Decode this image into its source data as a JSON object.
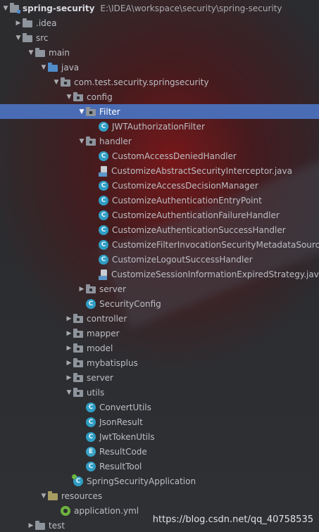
{
  "tree": [
    {
      "label": "spring-security",
      "path": "E:\\IDEA\\workspace\\security\\spring-security",
      "icon": "module-folder-icon",
      "arrow": "open"
    },
    {
      "label": ".idea",
      "icon": "folder-icon",
      "arrow": "closed"
    },
    {
      "label": "src",
      "icon": "folder-icon",
      "arrow": "open"
    },
    {
      "label": "main",
      "icon": "folder-icon",
      "arrow": "open"
    },
    {
      "label": "java",
      "icon": "source-folder-icon",
      "arrow": "open"
    },
    {
      "label": "com.test.security.springsecurity",
      "icon": "package-icon",
      "arrow": "open"
    },
    {
      "label": "config",
      "icon": "package-icon",
      "arrow": "open"
    },
    {
      "label": "Filter",
      "icon": "package-icon",
      "arrow": "open",
      "selected": true
    },
    {
      "label": "JWTAuthorizationFilter",
      "icon": "class-icon"
    },
    {
      "label": "handler",
      "icon": "package-icon",
      "arrow": "open"
    },
    {
      "label": "CustomAccessDeniedHandler",
      "icon": "class-icon"
    },
    {
      "label": "CustomizeAbstractSecurityInterceptor.java",
      "icon": "java-file-icon"
    },
    {
      "label": "CustomizeAccessDecisionManager",
      "icon": "class-icon"
    },
    {
      "label": "CustomizeAuthenticationEntryPoint",
      "icon": "class-icon"
    },
    {
      "label": "CustomizeAuthenticationFailureHandler",
      "icon": "class-icon"
    },
    {
      "label": "CustomizeAuthenticationSuccessHandler",
      "icon": "class-icon"
    },
    {
      "label": "CustomizeFilterInvocationSecurityMetadataSourc",
      "icon": "class-icon"
    },
    {
      "label": "CustomizeLogoutSuccessHandler",
      "icon": "class-icon"
    },
    {
      "label": "CustomizeSessionInformationExpiredStrategy.jav",
      "icon": "java-file-icon"
    },
    {
      "label": "server",
      "icon": "package-icon",
      "arrow": "closed"
    },
    {
      "label": "SecurityConfig",
      "icon": "class-icon"
    },
    {
      "label": "controller",
      "icon": "package-icon",
      "arrow": "closed"
    },
    {
      "label": "mapper",
      "icon": "package-icon",
      "arrow": "closed"
    },
    {
      "label": "model",
      "icon": "package-icon",
      "arrow": "closed"
    },
    {
      "label": "mybatisplus",
      "icon": "package-icon",
      "arrow": "closed"
    },
    {
      "label": "server",
      "icon": "package-icon",
      "arrow": "closed"
    },
    {
      "label": "utils",
      "icon": "package-icon",
      "arrow": "open"
    },
    {
      "label": "ConvertUtils",
      "icon": "class-icon"
    },
    {
      "label": "JsonResult",
      "icon": "class-icon"
    },
    {
      "label": "JwtTokenUtils",
      "icon": "class-icon"
    },
    {
      "label": "ResultCode",
      "icon": "enum-icon"
    },
    {
      "label": "ResultTool",
      "icon": "class-icon"
    },
    {
      "label": "SpringSecurityApplication",
      "icon": "spring-boot-class-icon"
    },
    {
      "label": "resources",
      "icon": "resources-folder-icon",
      "arrow": "open"
    },
    {
      "label": "application.yml",
      "icon": "yml-file-icon"
    },
    {
      "label": "test",
      "icon": "folder-icon",
      "arrow": "closed"
    }
  ],
  "icon_glyphs": {
    "class": "C",
    "enum": "E"
  },
  "watermark": "https://blog.csdn.net/qq_40758535",
  "colors": {
    "selection": "#4a6cb5",
    "class_icon": "#2f9dc4",
    "source_folder": "#4f8cc9",
    "spring": "#6db33f"
  }
}
